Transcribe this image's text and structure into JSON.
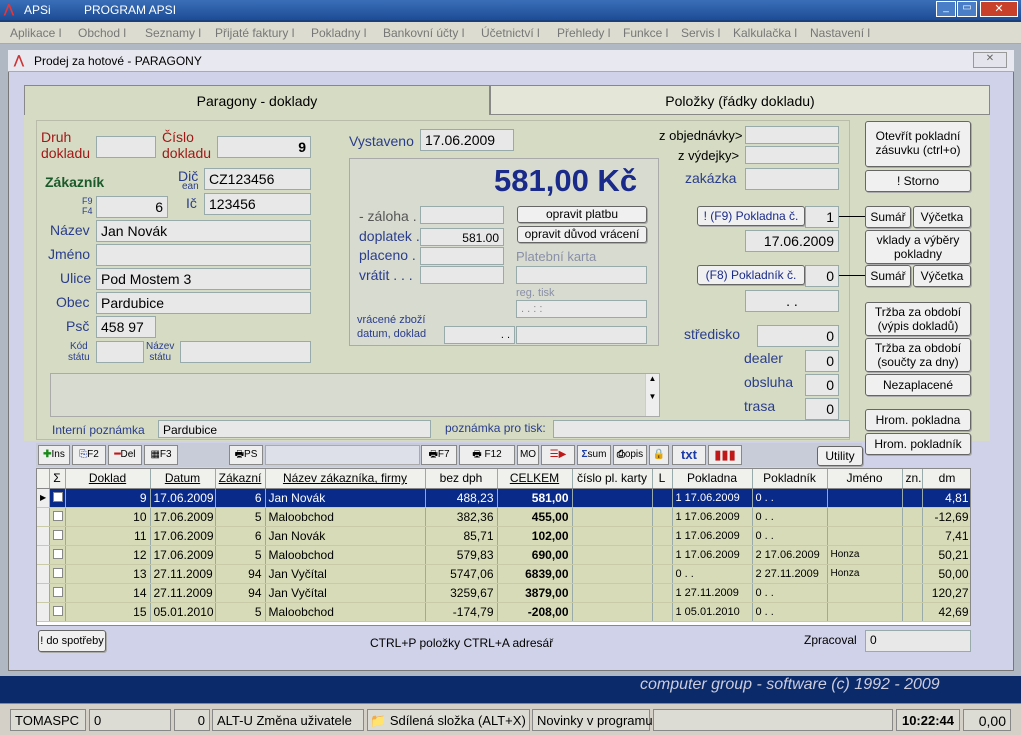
{
  "window": {
    "app_name": "APSi",
    "title": "PROGRAM APSI"
  },
  "menu": [
    "Aplikace l",
    "Obchod l",
    "Seznamy l",
    "Přijaté faktury l",
    "Pokladny l",
    "Bankovní účty l",
    "Účetnictví l",
    "Přehledy l",
    "Funkce l",
    "Servis l",
    "Kalkulačka l",
    "Nastavení l"
  ],
  "doc": {
    "title": "Prodej za hotové - PARAGONY"
  },
  "tabs": [
    "Paragony - doklady",
    "Položky  (řádky dokladu)"
  ],
  "form": {
    "druh_label": "Druh\ndokladu",
    "cislo_label": "Číslo\ndokladu",
    "cislo": "9",
    "zakaznik_label": "Zákazník",
    "dic_label": "Dič",
    "ean_label": "ean",
    "dic": "CZ123456",
    "ic_label": "Ič",
    "ic": "123456",
    "f9f4": "F9\nF4",
    "zak_num": "6",
    "nazev_label": "Název",
    "nazev": "Jan Novák",
    "jmeno_label": "Jméno",
    "jmeno": "",
    "ulice_label": "Ulice",
    "ulice": "Pod Mostem 3",
    "obec_label": "Obec",
    "obec": "Pardubice",
    "psc_label": "Psč",
    "psc": "458 97",
    "kod_statu": "Kód\nstátu",
    "nazev_statu": "Název\nstátu",
    "vystaveno_label": "Vystaveno",
    "vystaveno": "17.06.2009",
    "total": "581,00 Kč",
    "zaloha_label": "- záloha .",
    "doplatek_label": "doplatek .",
    "doplatek": "581.00",
    "placeno_label": "placeno .",
    "vratit_label": "vrátit . . .",
    "opravit_platbu": "opravit platbu",
    "opravit_duvod": "opravit důvod vrácení",
    "platebni_karta": "Platební karta",
    "reg_tisk": "reg. tisk",
    "reg_value": ". .    : :",
    "vracene": "vrácené zboží\ndatum, doklad",
    "vracene_val": ". .",
    "z_objednavky": "z objednávky>",
    "z_vydejky": "z výdejky>",
    "zakazka": "zakázka",
    "pokladna_btn": "! (F9)  Pokladna č.",
    "pokladna_num": "1",
    "pokladna_date": "17.06.2009",
    "pokladnik_btn": "(F8)  Pokladník č.",
    "pokladnik_num": "0",
    "pokladnik_val": ". .",
    "stredisko": "středisko",
    "stredisko_val": "0",
    "dealer": "dealer",
    "dealer_val": "0",
    "obsluha": "obsluha",
    "obsluha_val": "0",
    "trasa": "trasa",
    "trasa_val": "0",
    "interni": "Interní poznámka",
    "interni_val": "Pardubice",
    "poznamka_tisk": "poznámka pro tisk:"
  },
  "right_buttons": {
    "otevrit": "Otevřít pokladní\nzásuvku (ctrl+o)",
    "storno": "! Storno",
    "suma": "Sumář",
    "vycetka": "Výčetka",
    "vklady": "vklady a výběry\npokladny",
    "trzba_vypis": "Tržba za období\n(výpis dokladů)",
    "trzba_soucty": "Tržba za období\n(součty za dny)",
    "nezaplacene": "Nezaplacené",
    "hrom_pokladna": "Hrom. pokladna",
    "hrom_pokladnik": "Hrom. pokladník"
  },
  "toolbar": {
    "ins": "Ins",
    "f2": "F2",
    "del": "Del",
    "f3": "F3",
    "ps": "PS",
    "f7": "F7",
    "f12": "F12",
    "mo": "MO",
    "sum": "sum",
    "opis": "opis",
    "txt": "txt",
    "utility": "Utility"
  },
  "table": {
    "headers": [
      "Σ",
      "Doklad",
      "Datum",
      "Zákazní",
      "Název zákazníka, firmy",
      "bez dph",
      "CELKEM",
      "číslo pl. karty",
      "L",
      "Pokladna",
      "Pokladník",
      "Jméno",
      "zn.",
      "dm"
    ],
    "rows": [
      [
        "9",
        "17.06.2009",
        "6",
        "Jan Novák",
        "488,23",
        "581,00",
        "",
        "",
        "1 17.06.2009",
        "0  .  .",
        "",
        "",
        "4,81"
      ],
      [
        "10",
        "17.06.2009",
        "5",
        "Maloobchod",
        "382,36",
        "455,00",
        "",
        "",
        "1 17.06.2009",
        "0  .  .",
        "",
        "",
        "-12,69"
      ],
      [
        "11",
        "17.06.2009",
        "6",
        "Jan Novák",
        "85,71",
        "102,00",
        "",
        "",
        "1 17.06.2009",
        "0  .  .",
        "",
        "",
        "7,41"
      ],
      [
        "12",
        "17.06.2009",
        "5",
        "Maloobchod",
        "579,83",
        "690,00",
        "",
        "",
        "1 17.06.2009",
        "2 17.06.2009",
        "Honza",
        "",
        "50,21"
      ],
      [
        "13",
        "27.11.2009",
        "94",
        "Jan Vyčítal",
        "5747,06",
        "6839,00",
        "",
        "",
        "0  .  .",
        "2 27.11.2009",
        "Honza",
        "",
        "50,00"
      ],
      [
        "14",
        "27.11.2009",
        "94",
        "Jan Vyčítal",
        "3259,67",
        "3879,00",
        "",
        "",
        "1 27.11.2009",
        "0  .  .",
        "",
        "",
        "120,27"
      ],
      [
        "15",
        "05.01.2010",
        "5",
        "Maloobchod",
        "-174,79",
        "-208,00",
        "",
        "",
        "1 05.01.2010",
        "0  .  .",
        "",
        "",
        "42,69"
      ]
    ]
  },
  "footer": {
    "do_spotreby": "! do spotřeby",
    "ctrl_hint": "CTRL+P položky   CTRL+A adresář",
    "zpracoval": "Zpracoval",
    "zpracoval_val": "0"
  },
  "copyright": "computer group - software   (c) 1992 - 2009",
  "status": {
    "user": "TOMASPC",
    "a": "0",
    "b": "0",
    "alt_u": "ALT-U Změna uživatele",
    "sdilena": "Sdílená složka (ALT+X)",
    "novinky": "Novinky v programu",
    "time": "10:22:44",
    "amount": "0,00"
  }
}
